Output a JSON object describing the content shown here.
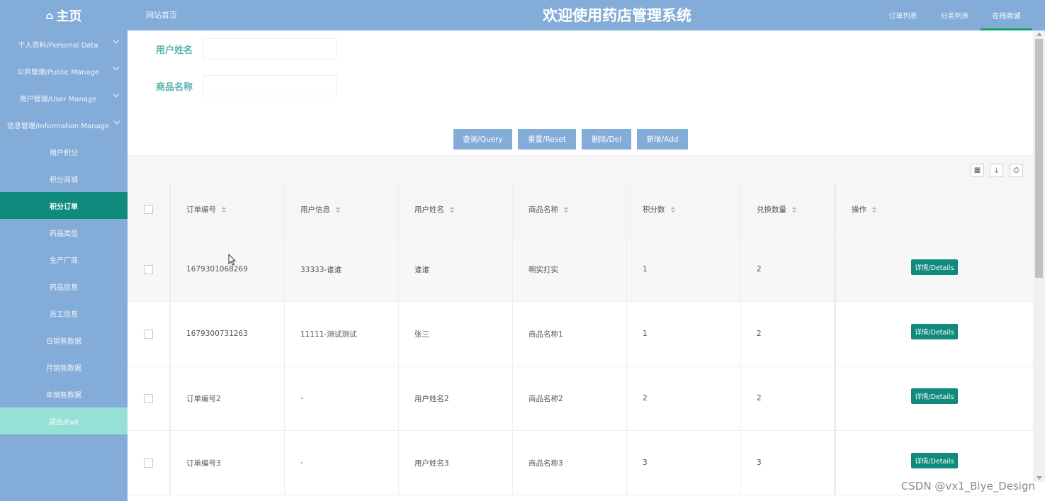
{
  "header": {
    "brand": "主页",
    "site_home": "网站首页",
    "title": "欢迎使用药店管理系统",
    "nav": [
      "订单列表",
      "分类列表",
      "在线商城"
    ]
  },
  "sidebar": {
    "groups": [
      "个人资料/Personal Data",
      "公共管理/Public Manage",
      "用户管理/User Manage",
      "信息管理/Information Manage"
    ],
    "items": [
      "用户积分",
      "积分商城",
      "积分订单",
      "药品类型",
      "生产厂商",
      "药品信息",
      "员工信息",
      "日销售数据",
      "月销售数据",
      "年销售数据"
    ],
    "active_item": "积分订单",
    "exit": "退出/Exit"
  },
  "search": {
    "user_name_label": "用户姓名",
    "user_name_value": "",
    "product_name_label": "商品名称",
    "product_name_value": ""
  },
  "buttons": {
    "query": "查询/Query",
    "reset": "重置/Reset",
    "delete": "删除/Del",
    "add": "新增/Add"
  },
  "toolbar_icons": [
    "columns-icon",
    "export-icon",
    "print-icon"
  ],
  "table": {
    "columns": [
      "订单编号",
      "用户信息",
      "用户姓名",
      "商品名称",
      "积分数",
      "兑换数量",
      "操作"
    ],
    "detail_label": "详情/Details",
    "rows": [
      [
        "1679301068269",
        "33333-谁谁",
        "谁谁",
        "啊实打实",
        "1",
        "2"
      ],
      [
        "1679300731263",
        "11111-测试测试",
        "张三",
        "商品名称1",
        "1",
        "2"
      ],
      [
        "订单编号2",
        "-",
        "用户姓名2",
        "商品名称2",
        "2",
        "2"
      ],
      [
        "订单编号3",
        "-",
        "用户姓名3",
        "商品名称3",
        "3",
        "3"
      ]
    ]
  },
  "colors": {
    "primary": "#84acd9",
    "accent": "#0f8a7d",
    "exit": "#96e1d5",
    "label": "#5ab4b0"
  },
  "watermark": "CSDN @vx1_Biye_Design"
}
